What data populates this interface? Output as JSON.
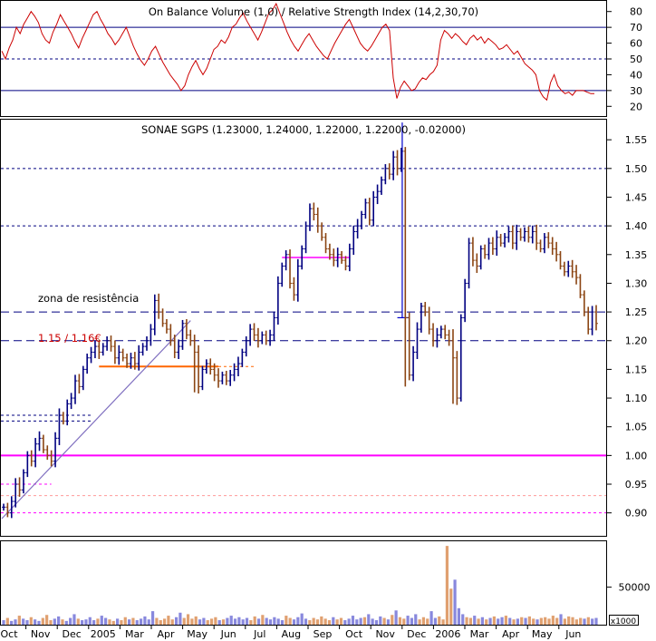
{
  "chart_data": [
    {
      "type": "line",
      "panel": "indicator",
      "title": "On Balance Volume (1,0) / Relative Strength Index (14,2,30,70)",
      "y_ticks": [
        80,
        70,
        60,
        50,
        40,
        30,
        20
      ],
      "ylim": [
        15,
        85
      ],
      "reference_lines": [
        70,
        50,
        30
      ],
      "series": [
        {
          "name": "Relative Strength Index",
          "color": "#cc0000",
          "x": [
            0,
            1,
            2,
            3,
            4,
            5,
            6,
            7,
            8,
            9,
            10,
            11,
            12,
            13,
            14,
            15,
            16,
            17,
            18,
            19,
            20,
            21,
            22,
            23,
            24,
            25,
            26,
            27,
            28,
            29,
            30,
            31,
            32,
            33,
            34,
            35,
            36,
            37,
            38,
            39,
            40,
            41,
            42,
            43,
            44,
            45,
            46,
            47,
            48,
            49,
            50,
            51,
            52,
            53,
            54,
            55,
            56,
            57,
            58,
            59,
            60,
            61,
            62,
            63,
            64,
            65,
            66,
            67,
            68,
            69,
            70,
            71,
            72,
            73,
            74,
            75,
            76,
            77,
            78,
            79,
            80,
            81,
            82,
            83,
            84,
            85,
            86,
            87,
            88,
            89,
            90,
            91,
            92,
            93,
            94,
            95,
            96,
            97,
            98,
            99,
            100,
            101,
            102,
            103,
            104,
            105,
            106,
            107,
            108,
            109,
            110,
            111,
            112,
            113,
            114,
            115,
            116,
            117,
            118,
            119,
            120,
            121,
            122,
            123,
            124,
            125,
            126,
            127,
            128,
            129,
            130,
            131,
            132,
            133,
            134,
            135,
            136,
            137,
            138,
            139,
            140,
            141,
            142,
            143,
            144,
            145,
            146,
            147,
            148,
            149,
            150,
            151,
            152,
            153,
            154,
            155,
            156,
            157,
            158,
            159,
            160,
            161,
            162
          ],
          "values": [
            55,
            50,
            57,
            62,
            70,
            66,
            72,
            76,
            80,
            77,
            73,
            66,
            62,
            60,
            67,
            72,
            78,
            74,
            70,
            66,
            61,
            57,
            63,
            68,
            73,
            78,
            80,
            75,
            71,
            66,
            63,
            59,
            62,
            66,
            70,
            64,
            58,
            53,
            49,
            46,
            50,
            55,
            58,
            53,
            48,
            44,
            40,
            37,
            34,
            30,
            33,
            40,
            45,
            49,
            44,
            40,
            44,
            50,
            56,
            58,
            62,
            60,
            64,
            70,
            72,
            76,
            79,
            74,
            70,
            66,
            62,
            67,
            73,
            79,
            81,
            85,
            79,
            73,
            67,
            62,
            58,
            55,
            59,
            63,
            66,
            62,
            58,
            55,
            52,
            50,
            55,
            60,
            64,
            68,
            72,
            75,
            70,
            65,
            60,
            57,
            55,
            58,
            62,
            66,
            70,
            72,
            68,
            38,
            25,
            32,
            36,
            33,
            30,
            31,
            35,
            38,
            37,
            40,
            42,
            46,
            62,
            68,
            66,
            63,
            66,
            64,
            61,
            59,
            63,
            65,
            62,
            64,
            60,
            63,
            61,
            59,
            56,
            57,
            59,
            56,
            53,
            55,
            51,
            47,
            45,
            43,
            40,
            30,
            26,
            24,
            35,
            40,
            33,
            30,
            28,
            29,
            27,
            30,
            30,
            30,
            29,
            28,
            28
          ]
        }
      ]
    },
    {
      "type": "candlestick",
      "panel": "price",
      "title": "SONAE SGPS (1.23000, 1.24000, 1.22000, 1.22000, -0.02000)",
      "y_ticks": [
        1.55,
        1.5,
        1.45,
        1.4,
        1.35,
        1.3,
        1.25,
        1.2,
        1.15,
        1.1,
        1.05,
        1.0,
        0.95,
        0.9
      ],
      "ylim": [
        0.86,
        1.585
      ],
      "annotations": [
        {
          "text": "zona de resistência",
          "color": "#000000"
        },
        {
          "text": "1.15 / 1.16€",
          "color": "#cc0000"
        }
      ],
      "horizontal_levels": [
        {
          "value": 1.0,
          "color": "#ff00ff",
          "style": "solid"
        },
        {
          "value": 1.5,
          "color": "#000080",
          "style": "dashed"
        },
        {
          "value": 1.4,
          "color": "#000080",
          "style": "dashed"
        },
        {
          "value": 1.25,
          "color": "#000080",
          "style": "dashed"
        },
        {
          "value": 1.2,
          "color": "#000080",
          "style": "dashed"
        },
        {
          "value": 0.9,
          "color": "#ff00ff",
          "style": "dashed"
        },
        {
          "value": 1.155,
          "color": "#ff6600",
          "style": "solid"
        },
        {
          "value": 1.345,
          "color": "#ff00ff",
          "style": "solid"
        }
      ],
      "close": [
        0.91,
        0.9,
        0.92,
        0.95,
        0.94,
        0.97,
        1.0,
        0.99,
        1.02,
        1.03,
        1.01,
        1.0,
        0.99,
        1.03,
        1.07,
        1.06,
        1.09,
        1.1,
        1.13,
        1.12,
        1.15,
        1.17,
        1.18,
        1.19,
        1.18,
        1.19,
        1.2,
        1.19,
        1.17,
        1.18,
        1.17,
        1.16,
        1.17,
        1.16,
        1.18,
        1.19,
        1.2,
        1.22,
        1.27,
        1.25,
        1.23,
        1.22,
        1.2,
        1.18,
        1.19,
        1.23,
        1.21,
        1.2,
        1.18,
        1.12,
        1.15,
        1.16,
        1.15,
        1.14,
        1.13,
        1.14,
        1.13,
        1.14,
        1.15,
        1.16,
        1.18,
        1.2,
        1.22,
        1.21,
        1.2,
        1.21,
        1.2,
        1.21,
        1.24,
        1.3,
        1.33,
        1.35,
        1.3,
        1.28,
        1.33,
        1.36,
        1.4,
        1.43,
        1.42,
        1.4,
        1.38,
        1.36,
        1.35,
        1.34,
        1.35,
        1.34,
        1.33,
        1.36,
        1.39,
        1.4,
        1.42,
        1.44,
        1.41,
        1.45,
        1.46,
        1.48,
        1.5,
        1.49,
        1.52,
        1.5,
        1.53,
        1.24,
        1.14,
        1.18,
        1.22,
        1.26,
        1.25,
        1.22,
        1.2,
        1.21,
        1.22,
        1.21,
        1.2,
        1.17,
        1.1,
        1.24,
        1.3,
        1.37,
        1.34,
        1.33,
        1.36,
        1.35,
        1.37,
        1.36,
        1.38,
        1.37,
        1.38,
        1.39,
        1.37,
        1.39,
        1.38,
        1.39,
        1.38,
        1.39,
        1.37,
        1.36,
        1.38,
        1.37,
        1.36,
        1.35,
        1.33,
        1.32,
        1.33,
        1.32,
        1.31,
        1.28,
        1.25,
        1.22,
        1.25,
        1.23
      ]
    },
    {
      "type": "bar",
      "panel": "volume",
      "title": "Volume",
      "y_ticks": [
        50000
      ],
      "unit": "x1000",
      "ylim": [
        0,
        110000
      ],
      "values": [
        6000,
        9000,
        5000,
        7000,
        12000,
        8000,
        6000,
        10000,
        7000,
        5000,
        9000,
        13000,
        6000,
        8000,
        11000,
        7000,
        5000,
        9000,
        14000,
        8000,
        6000,
        7000,
        10000,
        6000,
        8000,
        12000,
        9000,
        7000,
        5000,
        8000,
        6000,
        10000,
        7000,
        9000,
        6000,
        8000,
        11000,
        7000,
        18000,
        9000,
        6000,
        8000,
        12000,
        7000,
        10000,
        16000,
        9000,
        14000,
        8000,
        11000,
        7000,
        9000,
        6000,
        8000,
        10000,
        6000,
        7000,
        9000,
        12000,
        8000,
        10000,
        7000,
        9000,
        6000,
        11000,
        8000,
        13000,
        9000,
        7000,
        10000,
        8000,
        6000,
        12000,
        9000,
        7000,
        10000,
        15000,
        8000,
        6000,
        9000,
        7000,
        11000,
        8000,
        6000,
        10000,
        7000,
        9000,
        6000,
        8000,
        12000,
        7000,
        9000,
        10000,
        14000,
        8000,
        6000,
        11000,
        9000,
        7000,
        13000,
        19000,
        10000,
        8000,
        12000,
        9000,
        14000,
        7000,
        10000,
        8000,
        18000,
        9000,
        11000,
        7000,
        105000,
        48000,
        60000,
        22000,
        14000,
        10000,
        9000,
        12000,
        8000,
        10000,
        7000,
        9000,
        11000,
        8000,
        10000,
        12000,
        9000,
        7000,
        8000,
        10000,
        9000,
        11000,
        8000,
        7000,
        9000,
        10000,
        8000,
        12000,
        9000,
        14000,
        8000,
        11000,
        10000,
        7000,
        9000,
        8000,
        10000,
        8000,
        9000
      ]
    }
  ],
  "x_axis": {
    "labels": [
      "Oct",
      "Nov",
      "Dec",
      "2005",
      "Mar",
      "Apr",
      "May",
      "Jun",
      "Jul",
      "Aug",
      "Sep",
      "Oct",
      "Nov",
      "Dec",
      "2006",
      "Mar",
      "Apr",
      "May",
      "Jun"
    ]
  },
  "colors": {
    "up_bar": "#000080",
    "down_bar": "#8b4513",
    "volume_up": "#8888dd",
    "volume_down": "#e0a070",
    "rsi": "#cc0000",
    "trendline": "#8070c0"
  }
}
